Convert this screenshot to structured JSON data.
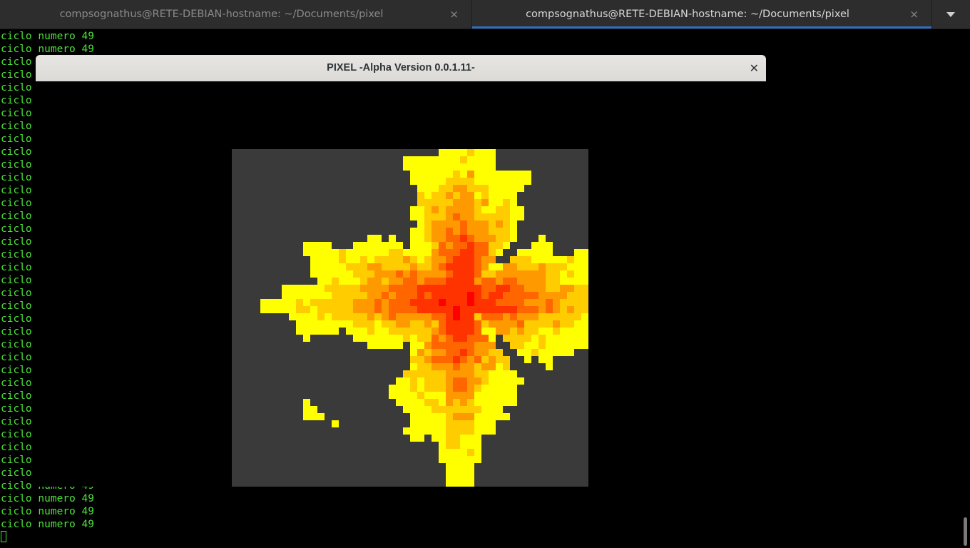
{
  "tabs": [
    {
      "title": "compsognathus@RETE-DEBIAN-hostname: ~/Documents/pixel",
      "close": "×",
      "active": false
    },
    {
      "title": "compsognathus@RETE-DEBIAN-hostname: ~/Documents/pixel",
      "close": "×",
      "active": true
    }
  ],
  "terminal": {
    "full_line": "ciclo numero 49",
    "short_line": "ciclo",
    "text_color": "#4ce23a"
  },
  "window": {
    "title": "PIXEL -Alpha Version 0.0.1.11-",
    "close": "✕"
  },
  "colors": {
    "red": "#ff0000",
    "orange_red": "#ff3300",
    "orange": "#ff6600",
    "orange_light": "#ff9900",
    "amber": "#ffcc00",
    "yellow": "#ffff00",
    "canvas_bg": "#3a3a3a",
    "terminal_bg": "#000000"
  }
}
